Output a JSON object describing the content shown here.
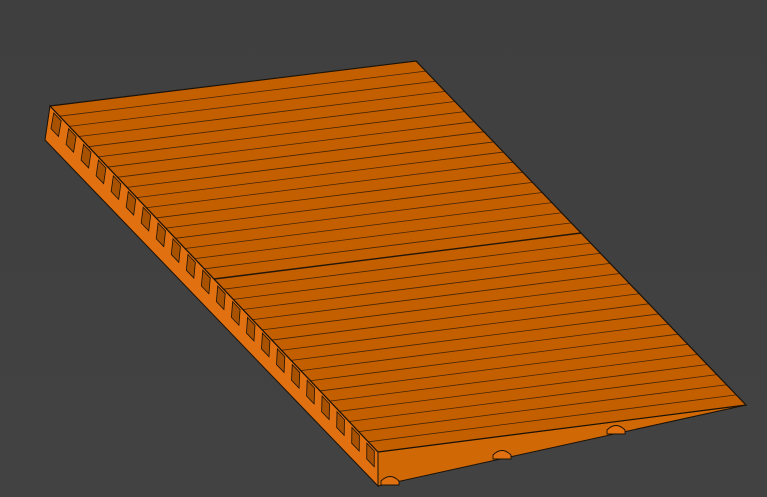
{
  "viewport": {
    "background_top": "#3f3f3f",
    "background_bottom": "#424242"
  },
  "model": {
    "object": "ramp-icon",
    "slat_count": 34,
    "colors": {
      "top_face": "#c45f00",
      "top_face_light": "#d06806",
      "side_face": "#e07010",
      "rib_face": "#a85200",
      "edge": "#1a1208"
    }
  }
}
